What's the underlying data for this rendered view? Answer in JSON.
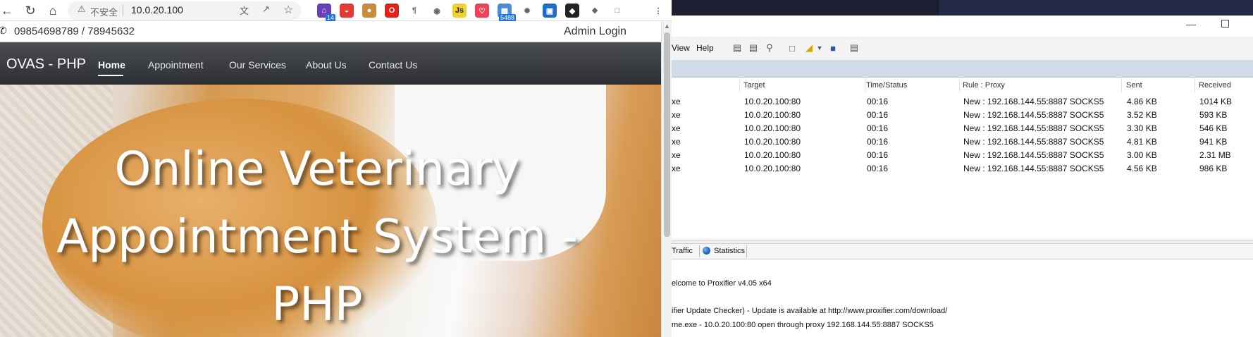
{
  "browser": {
    "nav_back_icon": "arrow-left-icon",
    "reload_icon": "reload-icon",
    "home_icon": "home-icon",
    "security_label": "不安全",
    "url": "10.0.20.100",
    "extensions": [
      {
        "name": "graduation-cap-icon",
        "color": "#6a3fb3",
        "badge": "14"
      },
      {
        "name": "pokeball-icon",
        "color": "#e53935",
        "badge": ""
      },
      {
        "name": "cookie-icon",
        "color": "#c98b3c",
        "badge": ""
      },
      {
        "name": "opera-icon",
        "color": "#e0201b",
        "badge": ""
      },
      {
        "name": "pilcrow-icon",
        "color": "#ffffff",
        "badge": ""
      },
      {
        "name": "eye-icon",
        "color": "#ffffff",
        "badge": ""
      },
      {
        "name": "js-icon",
        "color": "#f2d230",
        "badge": ""
      },
      {
        "name": "pocket-icon",
        "color": "#ef4056",
        "badge": ""
      },
      {
        "name": "counter-icon",
        "color": "#4b8bd6",
        "badge": "5488"
      },
      {
        "name": "bug-icon",
        "color": "#9e9e9e",
        "badge": ""
      },
      {
        "name": "translate-icon",
        "color": "#1e6ec8",
        "badge": ""
      },
      {
        "name": "ninja-icon",
        "color": "#222222",
        "badge": ""
      },
      {
        "name": "puzzle-icon",
        "color": "#5f6368",
        "badge": ""
      },
      {
        "name": "sidepanel-icon",
        "color": "#5f6368",
        "badge": ""
      },
      {
        "name": "menu-icon",
        "color": "#5f6368",
        "badge": ""
      }
    ]
  },
  "site": {
    "phone": "09854698789 / 78945632",
    "admin_login": "Admin Login",
    "brand": "OVAS - PHP",
    "nav": [
      "Home",
      "Appointment",
      "Our Services",
      "About Us",
      "Contact Us"
    ],
    "hero_title_lines": [
      "Online Veterinary",
      "Appointment System -",
      "PHP"
    ]
  },
  "proxifier": {
    "menus": [
      "View",
      "Help"
    ],
    "columns": [
      "Target",
      "Time/Status",
      "Rule : Proxy",
      "Sent",
      "Received"
    ],
    "rows": [
      {
        "app": "xe",
        "target": "10.0.20.100:80",
        "time": "00:16",
        "rule": "New : 192.168.144.55:8887 SOCKS5",
        "sent": "4.86 KB",
        "received": "1014 KB"
      },
      {
        "app": "xe",
        "target": "10.0.20.100:80",
        "time": "00:16",
        "rule": "New : 192.168.144.55:8887 SOCKS5",
        "sent": "3.52 KB",
        "received": "593 KB"
      },
      {
        "app": "xe",
        "target": "10.0.20.100:80",
        "time": "00:16",
        "rule": "New : 192.168.144.55:8887 SOCKS5",
        "sent": "3.30 KB",
        "received": "546 KB"
      },
      {
        "app": "xe",
        "target": "10.0.20.100:80",
        "time": "00:16",
        "rule": "New : 192.168.144.55:8887 SOCKS5",
        "sent": "4.81 KB",
        "received": "941 KB"
      },
      {
        "app": "xe",
        "target": "10.0.20.100:80",
        "time": "00:16",
        "rule": "New : 192.168.144.55:8887 SOCKS5",
        "sent": "3.00 KB",
        "received": "2.31 MB"
      },
      {
        "app": "xe",
        "target": "10.0.20.100:80",
        "time": "00:16",
        "rule": "New : 192.168.144.55:8887 SOCKS5",
        "sent": "4.56 KB",
        "received": "986 KB"
      }
    ],
    "tabs": [
      "Traffic",
      "Statistics"
    ],
    "log_lines": [
      "elcome to Proxifier v4.05 x64",
      "ifier Update Checker) - Update is available at http://www.proxifier.com/download/",
      "me.exe - 10.0.20.100:80 open through proxy 192.168.144.55:8887 SOCKS5"
    ]
  }
}
